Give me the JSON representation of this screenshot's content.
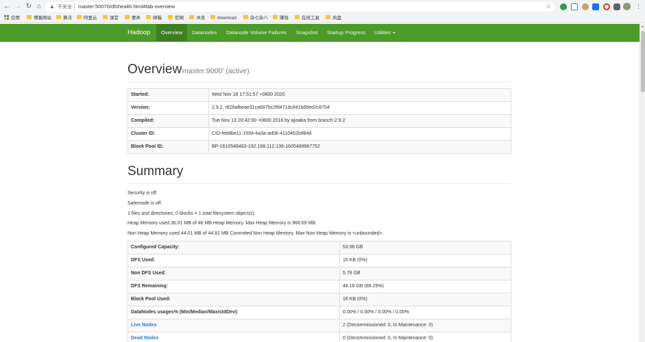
{
  "browser": {
    "insecure_label": "不安全",
    "url": "master:50070/dfshealth.html#tab-overview",
    "bookmarks": [
      "应用",
      "博客网站",
      "算法",
      "阿里云",
      "课堂",
      "要弄",
      "邮箱",
      "官网",
      "冲浪",
      "download",
      "杂七杂八",
      "赚钱",
      "在线工具",
      "风盘"
    ]
  },
  "navbar": {
    "brand": "Hadoop",
    "items": [
      "Overview",
      "Datanodes",
      "Datanode Volume Failures",
      "Snapshot",
      "Startup Progress",
      "Utilities"
    ],
    "active": "Overview",
    "color": "#4c9a2a"
  },
  "overview": {
    "title": "Overview",
    "subtitle": "'master:9000' (active)",
    "rows": [
      {
        "key": "Started:",
        "value": "Wed Nov 18 17:51:57 +0800 2020"
      },
      {
        "key": "Version:",
        "value": "2.9.2, r826afbeae31ca687bc2f8471dc841b66ed2c6704"
      },
      {
        "key": "Compiled:",
        "value": "Tue Nov 13 20:42:00 +0800 2018 by ajisaka from branch-2.9.2"
      },
      {
        "key": "Cluster ID:",
        "value": "CID-feb8be11-1594-4a3a-ad08-4110462b984d"
      },
      {
        "key": "Block Pool ID:",
        "value": "BP-1610548483-192.168.112.136-1605489967752"
      }
    ]
  },
  "summary": {
    "title": "Summary",
    "lines": [
      "Security is off.",
      "Safemode is off.",
      "1 files and directories, 0 blocks = 1 total filesystem object(s).",
      "Heap Memory used 36.01 MB of 46 MB Heap Memory. Max Heap Memory is 966.69 MB.",
      "Non Heap Memory used 44.01 MB of 44.81 MB Commited Non Heap Memory. Max Non Heap Memory is <unbounded>."
    ],
    "rows": [
      {
        "key": "Configured Capacity:",
        "value": "53.96 GB"
      },
      {
        "key": "DFS Used:",
        "value": "16 KB (0%)"
      },
      {
        "key": "Non DFS Used:",
        "value": "5.78 GB"
      },
      {
        "key": "DFS Remaining:",
        "value": "48.18 GB (89.29%)"
      },
      {
        "key": "Block Pool Used:",
        "value": "16 KB (0%)"
      },
      {
        "key": "DataNodes usages% (Min/Median/Max/stdDev):",
        "value": "0.00% / 0.00% / 0.00% / 0.00%"
      },
      {
        "key": "Live Nodes",
        "value": "2 (Decommissioned: 0, In Maintenance: 0)"
      },
      {
        "key": "Dead Nodes",
        "value": "0 (Decommissioned: 0, In Maintenance: 0)"
      }
    ]
  }
}
